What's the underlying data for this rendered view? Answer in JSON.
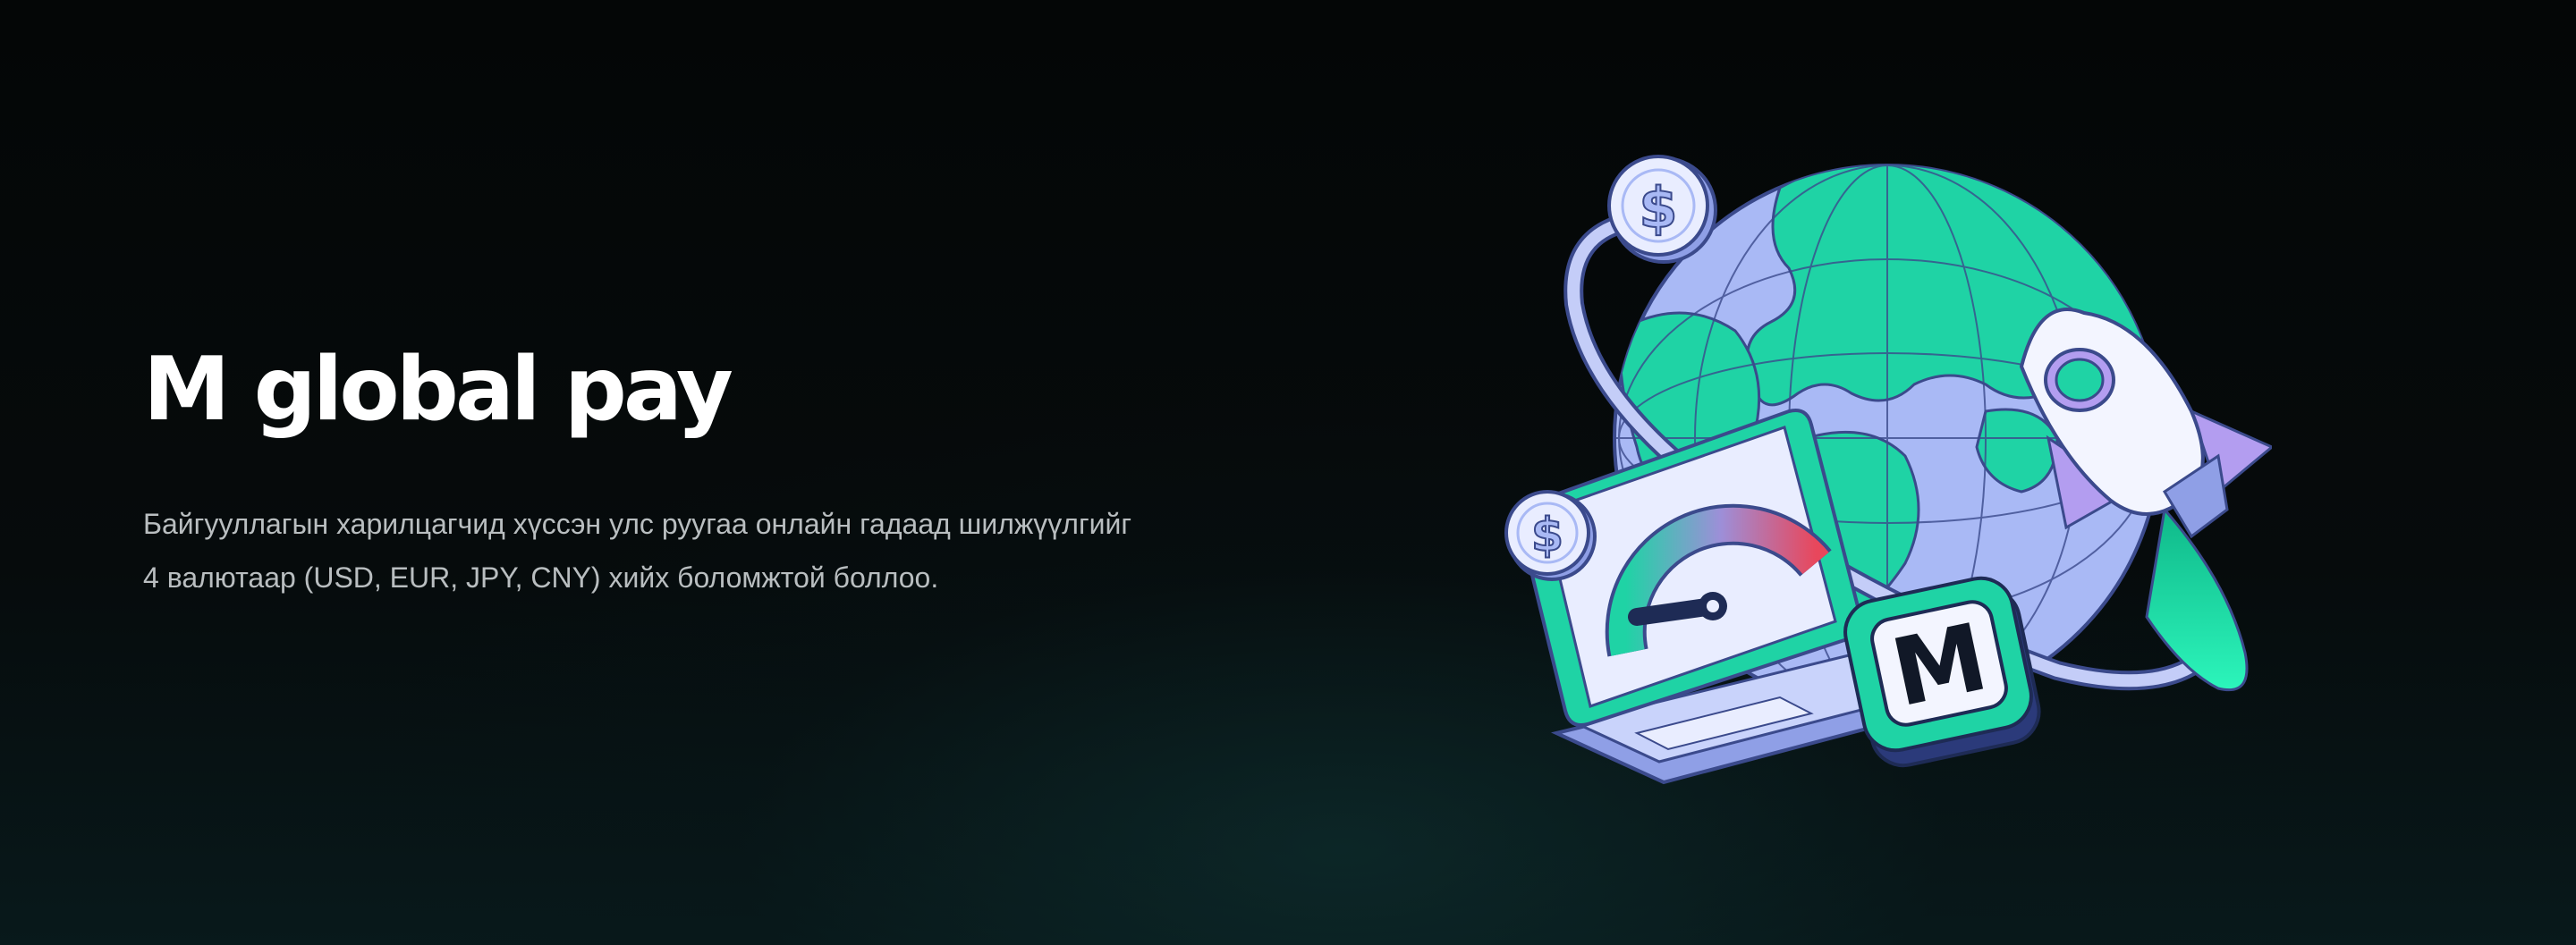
{
  "hero": {
    "title": "M global pay",
    "description_line1": "Байгууллагын харилцагчид хүссэн улс руугаа онлайн гадаад шилжүүлгийг",
    "description_line2": "4 валютаар (USD, EUR, JPY, CNY) хийх боломжтой боллоо.",
    "illustration": {
      "coin_symbol": "$",
      "badge_letter": "M",
      "icons": [
        "globe-icon",
        "dollar-coin-icon",
        "laptop-icon",
        "speedometer-gauge-icon",
        "rocket-icon",
        "m-badge-icon"
      ],
      "colors": {
        "ocean": "#a9b9f5",
        "land": "#1fd3a5",
        "outline": "#3b4a8c",
        "rocket_fin": "#b39df0",
        "flame": "#19e3a8",
        "gauge_low": "#1fd3a5",
        "gauge_high": "#e8475c"
      }
    }
  }
}
